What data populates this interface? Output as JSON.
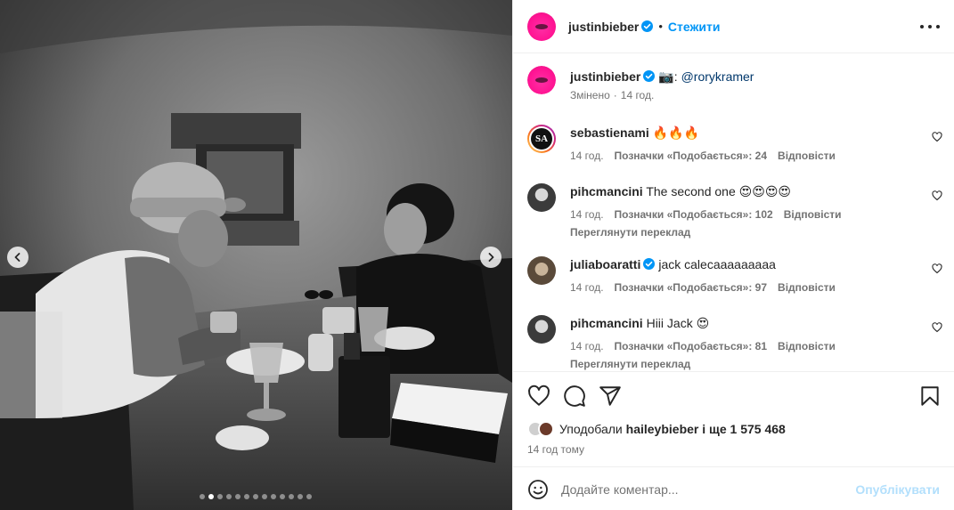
{
  "post": {
    "author": "justinbieber",
    "follow_label": "Стежити",
    "separator": "•",
    "caption_prefix": "📷: ",
    "caption_mention": "@rorykramer",
    "edited": "Змінено",
    "edited_sep": "·",
    "edited_time": "14 год."
  },
  "carousel": {
    "slide_count": 13,
    "active_index": 1
  },
  "comments": [
    {
      "user": "sebastienami",
      "text": "🔥🔥🔥",
      "time": "14 год.",
      "likes": "Позначки «Подобається»: 24",
      "reply": "Відповісти",
      "translate": "",
      "avatar_initials": "SA"
    },
    {
      "user": "pihcmancini",
      "text": "The second one 😍😍😍😍",
      "time": "14 год.",
      "likes": "Позначки «Подобається»: 102",
      "reply": "Відповісти",
      "translate": "Переглянути переклад"
    },
    {
      "user": "juliaboaratti",
      "text": "jack calecaaaaaaaaa",
      "time": "14 год.",
      "likes": "Позначки «Подобається»: 97",
      "reply": "Відповісти",
      "translate": ""
    },
    {
      "user": "pihcmancini",
      "text": "Hiii Jack 😍",
      "time": "14 год.",
      "likes": "Позначки «Подобається»: 81",
      "reply": "Відповісти",
      "translate": "Переглянути переклад"
    }
  ],
  "likes": {
    "prefix": "Уподобали ",
    "user": "haileybieber",
    "suffix": " і ще 1 575 468"
  },
  "time_ago": "14 год тому",
  "comment_input": {
    "placeholder": "Додайте коментар...",
    "publish_label": "Опублікувати"
  },
  "colors": {
    "accent": "#0095f6",
    "verified": "#0095f6",
    "publish_disabled": "#b2dffc",
    "muted": "#737373"
  },
  "icons": [
    "chevron-left-icon",
    "chevron-right-icon",
    "more-icon",
    "heart-icon",
    "comment-icon",
    "share-icon",
    "bookmark-icon",
    "emoji-icon",
    "verified-icon"
  ]
}
